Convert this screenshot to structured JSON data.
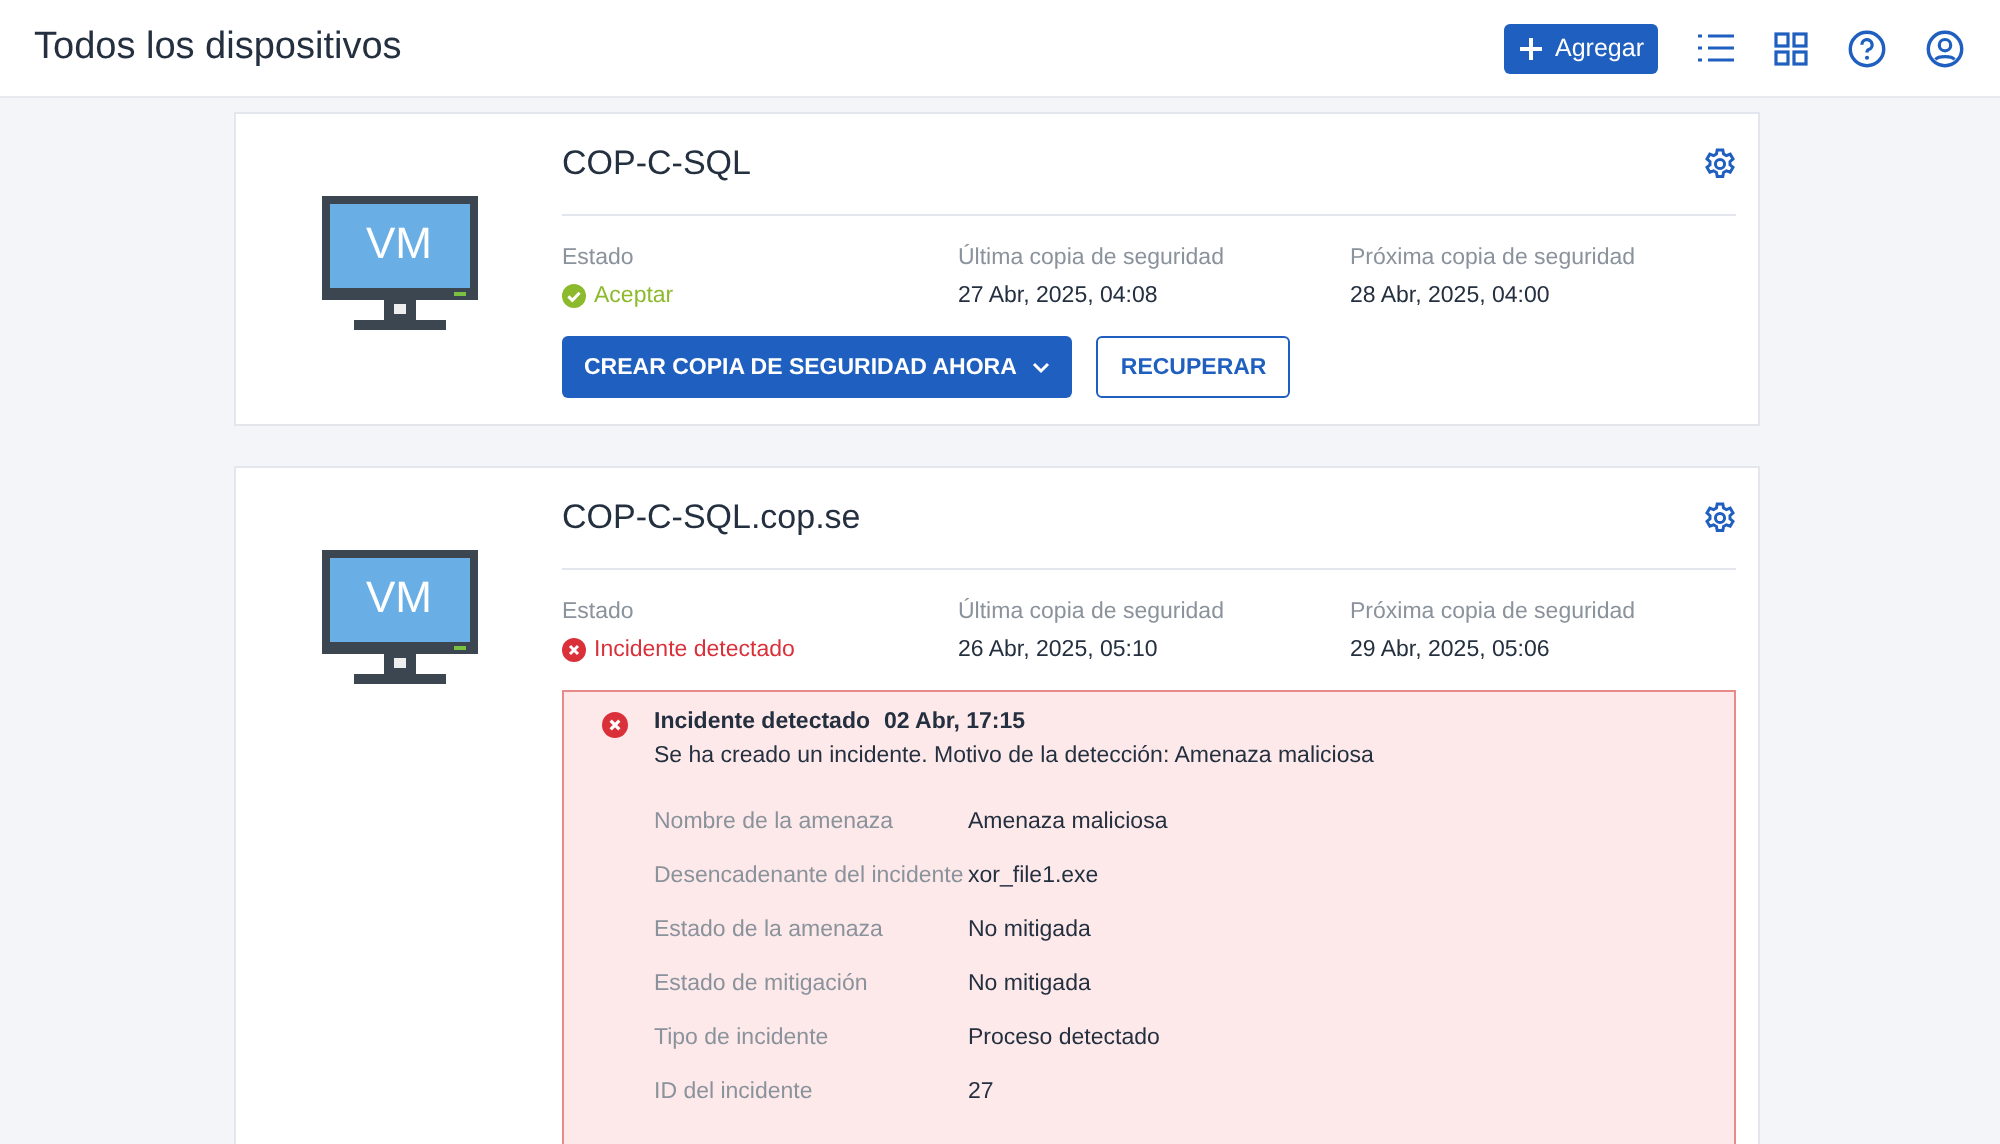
{
  "header": {
    "title": "Todos los dispositivos",
    "add_button": "Agregar"
  },
  "devices": [
    {
      "name": "COP-C-SQL",
      "icon_label": "VM",
      "status_label": "Estado",
      "status": {
        "kind": "ok",
        "text": "Aceptar"
      },
      "last_label": "Última copia de seguridad",
      "last": "27 Abr, 2025, 04:08",
      "next_label": "Próxima copia de seguridad",
      "next": "28 Abr, 2025, 04:00",
      "buttons": [
        {
          "kind": "primary",
          "label": "CREAR COPIA DE SEGURIDAD AHORA"
        },
        {
          "kind": "secondary",
          "label": "RECUPERAR"
        }
      ]
    },
    {
      "name": "COP-C-SQL.cop.se",
      "icon_label": "VM",
      "status_label": "Estado",
      "status": {
        "kind": "incident",
        "text": "Incidente detectado"
      },
      "last_label": "Última copia de seguridad",
      "last": "26 Abr, 2025, 05:10",
      "next_label": "Próxima copia de seguridad",
      "next": "29 Abr, 2025, 05:06",
      "incident": {
        "title": "Incidente detectado",
        "time": "02 Abr, 17:15",
        "message": "Se ha creado un incidente. Motivo de la detección: Amenaza maliciosa",
        "details": [
          {
            "label": "Nombre de la amenaza",
            "value": "Amenaza maliciosa"
          },
          {
            "label": "Desencadenante del incidente",
            "value": "xor_file1.exe"
          },
          {
            "label": "Estado de la amenaza",
            "value": "No mitigada"
          },
          {
            "label": "Estado de mitigación",
            "value": "No mitigada"
          },
          {
            "label": "Tipo de incidente",
            "value": "Proceso detectado"
          },
          {
            "label": "ID del incidente",
            "value": "27"
          }
        ]
      }
    }
  ]
}
